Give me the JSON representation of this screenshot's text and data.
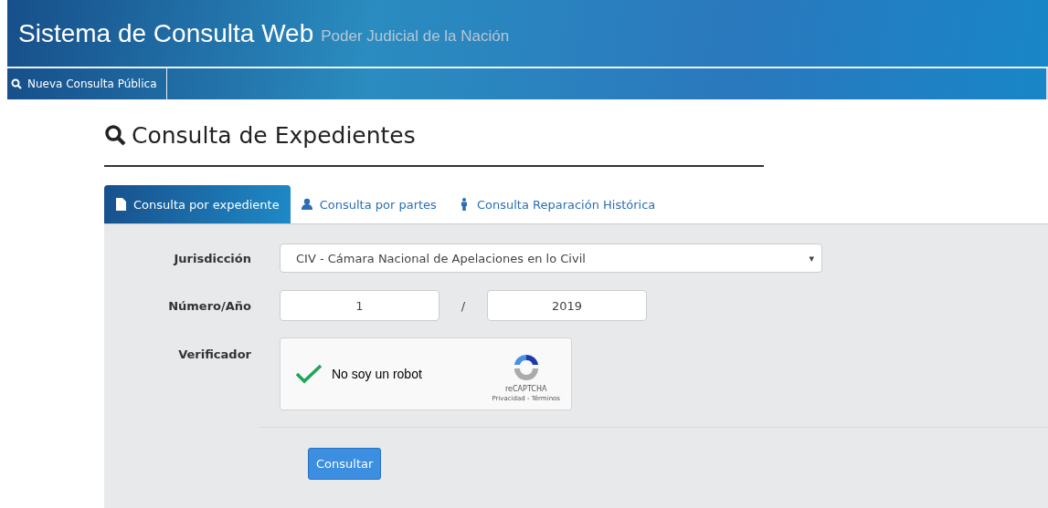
{
  "header": {
    "title": "Sistema de Consulta Web",
    "subtitle": "Poder Judicial de la Nación"
  },
  "nav": {
    "items": [
      {
        "label": "Nueva Consulta Pública"
      }
    ]
  },
  "page": {
    "title": "Consulta de Expedientes"
  },
  "tabs": [
    {
      "label": "Consulta por expediente",
      "kind": "file",
      "selected": true
    },
    {
      "label": "Consulta por partes",
      "kind": "user",
      "selected": false
    },
    {
      "label": "Consulta Reparación Histórica",
      "kind": "person",
      "selected": false
    }
  ],
  "form": {
    "jurisdiction": {
      "label": "Jurisdicción",
      "value": "CIV - Cámara Nacional de Apelaciones en lo Civil",
      "caret": "▾"
    },
    "number_year": {
      "label": "Número/Año",
      "number": "1",
      "separator": "/",
      "year": "2019"
    },
    "verifier": {
      "label": "Verificador",
      "captcha": {
        "checked": true,
        "text": "No soy un robot",
        "brand": "reCAPTCHA",
        "links": "Privacidad - Términos"
      }
    },
    "submit": "Consultar"
  }
}
